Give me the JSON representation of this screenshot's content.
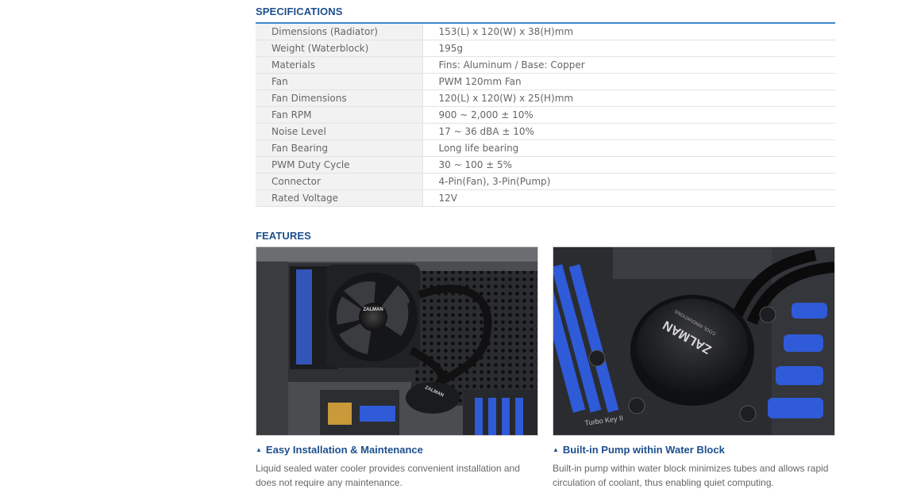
{
  "specifications": {
    "title": "SPECIFICATIONS",
    "rows": [
      {
        "label": "Dimensions (Radiator)",
        "value": "153(L) x 120(W) x 38(H)mm"
      },
      {
        "label": "Weight (Waterblock)",
        "value": "195g"
      },
      {
        "label": "Materials",
        "value": "Fins: Aluminum / Base: Copper"
      },
      {
        "label": "Fan",
        "value": "PWM 120mm Fan"
      },
      {
        "label": "Fan Dimensions",
        "value": "120(L) x 120(W) x 25(H)mm"
      },
      {
        "label": "Fan RPM",
        "value": "900 ~ 2,000 ± 10%"
      },
      {
        "label": "Noise Level",
        "value": "17 ~ 36 dBA ± 10%"
      },
      {
        "label": "Fan Bearing",
        "value": "Long life bearing"
      },
      {
        "label": "PWM Duty Cycle",
        "value": "30 ~ 100 ± 5%"
      },
      {
        "label": "Connector",
        "value": "4-Pin(Fan), 3-Pin(Pump)"
      },
      {
        "label": "Rated Voltage",
        "value": "12V"
      }
    ]
  },
  "features": {
    "title": "FEATURES",
    "items": [
      {
        "heading": "Easy Installation & Maintenance",
        "description": "Liquid sealed water cooler provides convenient installation and does not require any maintenance.",
        "brand": "ZALMAN",
        "brand_small": "ZALMAN"
      },
      {
        "heading": "Built-in Pump within Water Block",
        "description": "Built-in pump within water block minimizes tubes and allows rapid circulation of coolant, thus enabling quiet computing.",
        "brand": "ZALMAN",
        "brand_sub": "COOL INNOVATIONS",
        "board_text": "Turbo Key II"
      }
    ]
  },
  "colors": {
    "accent": "#1e4f8f",
    "rule": "#3e88cc",
    "label_bg": "#f2f2f2",
    "board_blue": "#2f5ad8"
  }
}
